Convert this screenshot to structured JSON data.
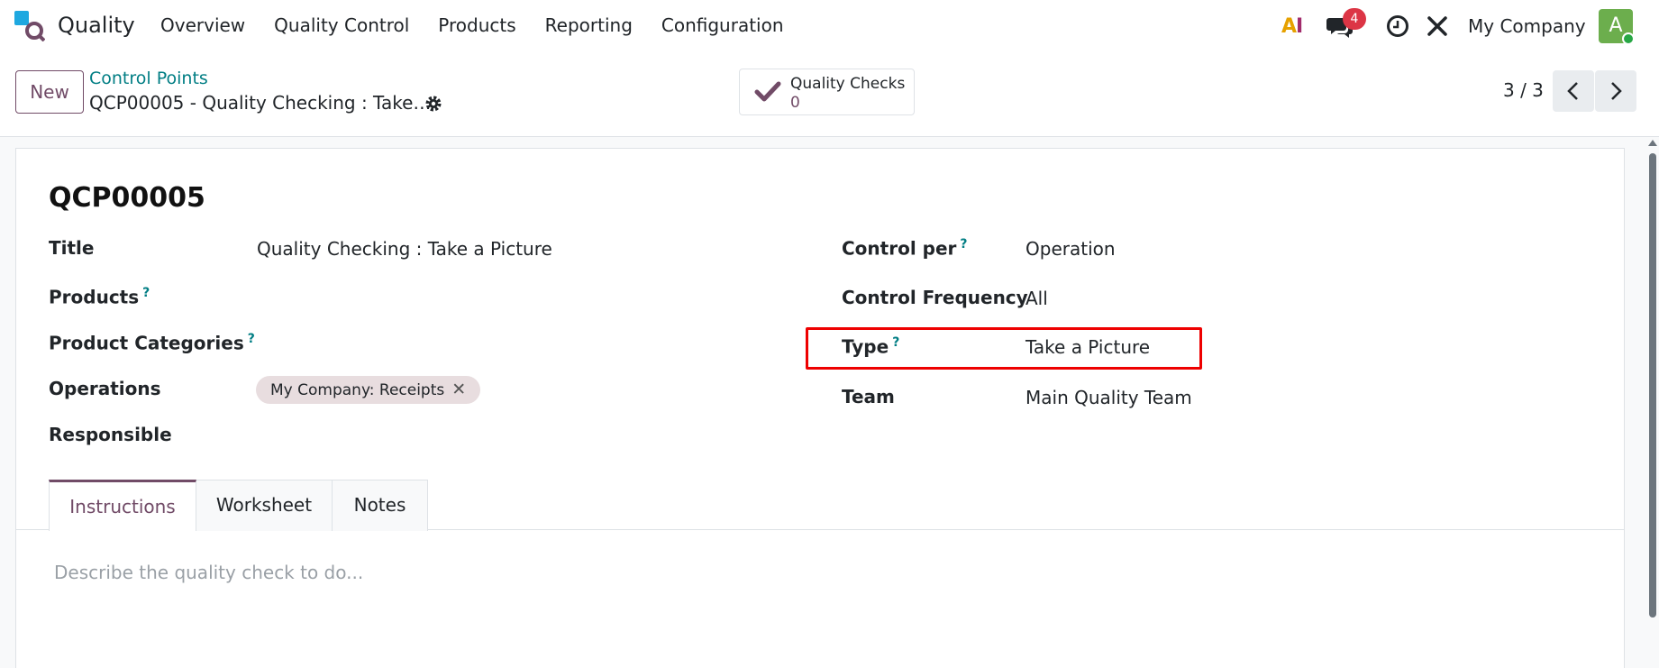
{
  "app": {
    "name": "Quality",
    "menu": [
      "Overview",
      "Quality Control",
      "Products",
      "Reporting",
      "Configuration"
    ]
  },
  "systray": {
    "ai_label": "AI",
    "messages_count": "4",
    "company": "My Company",
    "avatar_letter": "A"
  },
  "control_panel": {
    "new_label": "New",
    "breadcrumb": "Control Points",
    "record_title": "QCP00005 - Quality Checking : Take…",
    "smart_button": {
      "label": "Quality Checks",
      "value": "0"
    },
    "pager": "3 / 3"
  },
  "form": {
    "name": "QCP00005",
    "left_fields": [
      {
        "label": "Title",
        "value": "Quality Checking : Take a Picture"
      },
      {
        "label": "Products",
        "value": ""
      },
      {
        "label": "Product Categories",
        "value": ""
      },
      {
        "label": "Operations",
        "value": ""
      },
      {
        "label": "Responsible",
        "value": ""
      }
    ],
    "operations_tag": "My Company: Receipts",
    "right_fields": [
      {
        "label": "Control per",
        "value": "Operation"
      },
      {
        "label": "Control Frequency",
        "value": "All"
      },
      {
        "label": "Type",
        "value": "Take a Picture"
      },
      {
        "label": "Team",
        "value": "Main Quality Team"
      }
    ],
    "help_marker": "?"
  },
  "tabs": [
    "Instructions",
    "Worksheet",
    "Notes"
  ],
  "instructions_placeholder": "Describe the quality check to do...",
  "colors": {
    "brand": "#714b67",
    "link": "#017e84",
    "highlight": "#e00000",
    "badge": "#dc3545"
  }
}
